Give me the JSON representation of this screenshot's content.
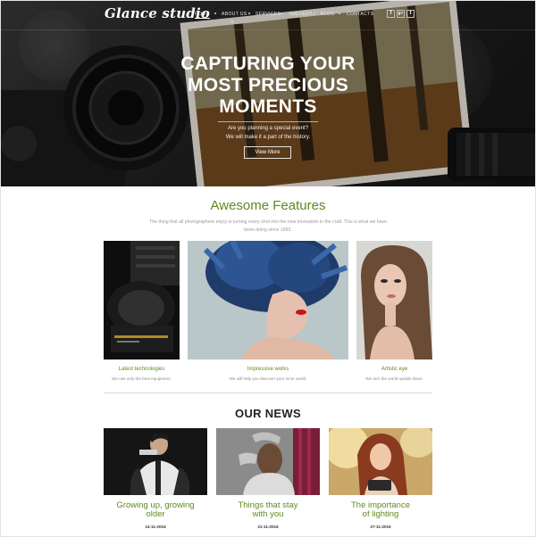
{
  "brand": {
    "logo": "Glance studio"
  },
  "nav": {
    "items": [
      {
        "label": "HOME",
        "active": true
      },
      {
        "label": "ABOUT US",
        "has_dropdown": true
      },
      {
        "label": "SERVICES"
      },
      {
        "label": "GALLERY"
      },
      {
        "label": "BLOG"
      },
      {
        "label": "CONTACTS"
      }
    ],
    "social": [
      "f",
      "g+",
      "t"
    ]
  },
  "hero": {
    "title_line1": "CAPTURING YOUR",
    "title_line2": "MOST PRECIOUS",
    "title_line3": "MOMENTS",
    "sub_line1": "Are you planning a special event?",
    "sub_line2": "We will make it a part of the history.",
    "button": "View More"
  },
  "features": {
    "title": "Awesome Features",
    "description_line1": "The thing that all photographers enjoy is turning every shot into the new innovation in the craft. This is what we have",
    "description_line2": "been doing since 1993.",
    "items": [
      {
        "label": "Latest technologies",
        "caption": "We use only the best equipment."
      },
      {
        "label": "Impressive works",
        "caption": "We will help you discover your inner world."
      },
      {
        "label": "Artistic eye",
        "caption": "We turn the world upside down."
      }
    ]
  },
  "news": {
    "title": "OUR NEWS",
    "items": [
      {
        "headline_line1": "Growing up, growing",
        "headline_line2": "older",
        "date": "14-11-2016"
      },
      {
        "headline_line1": "Things that stay",
        "headline_line2": "with you",
        "date": "21-11-2016"
      },
      {
        "headline_line1": "The importance",
        "headline_line2": "of lighting",
        "date": "27-11-2016"
      }
    ]
  },
  "colors": {
    "accent": "#5d8a1f",
    "hero_bg": "#222222",
    "text_dark": "#222222",
    "text_muted": "#9a9a9a"
  }
}
